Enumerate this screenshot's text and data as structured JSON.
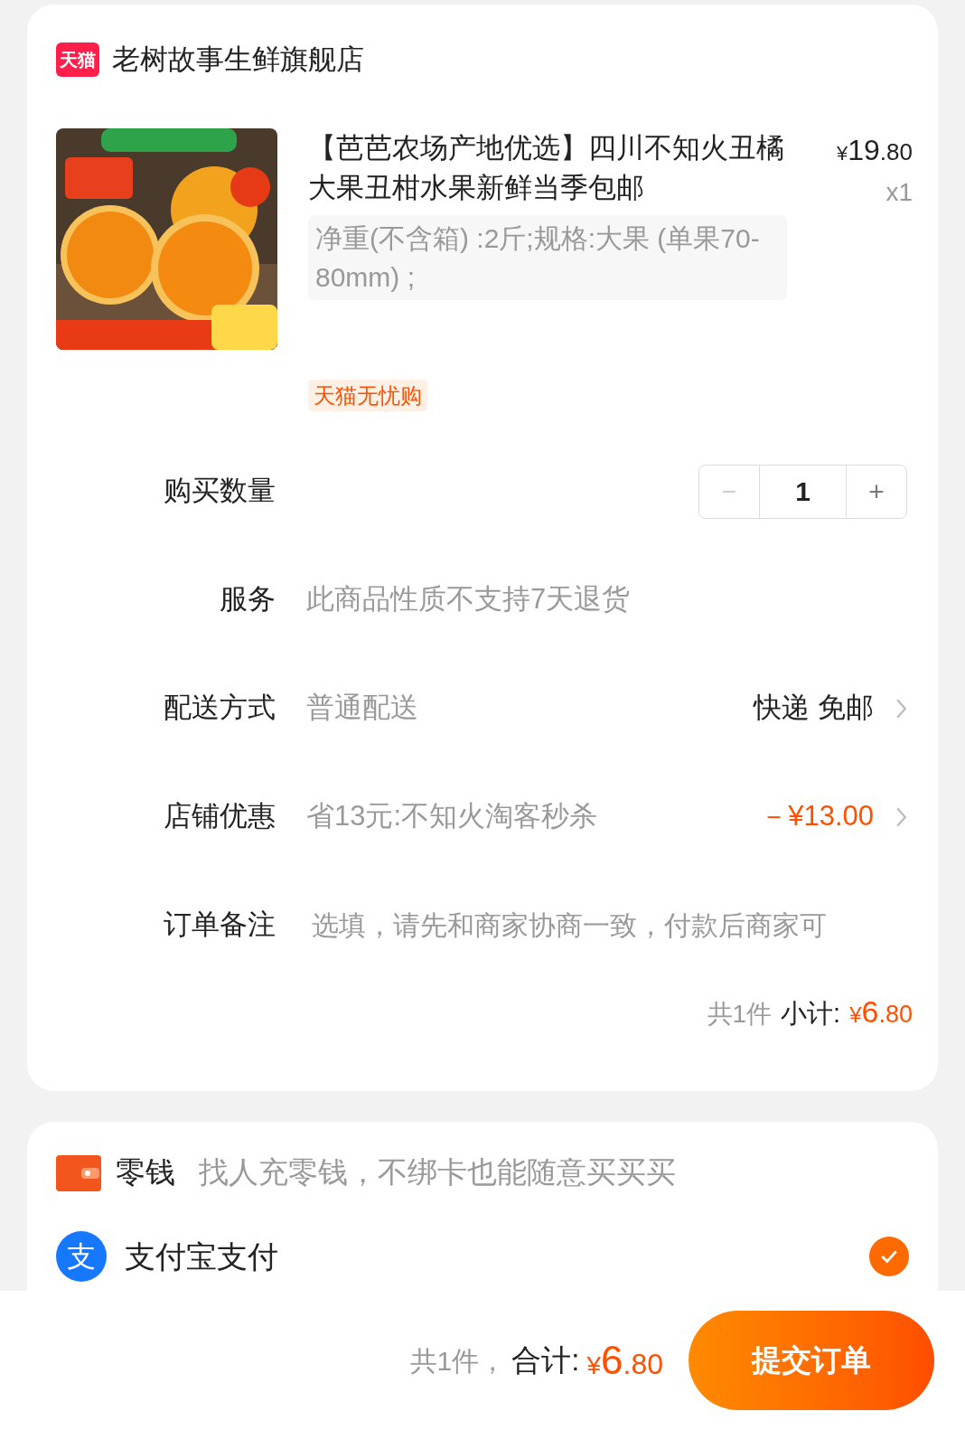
{
  "store": {
    "badge": "天猫",
    "name": "老树故事生鲜旗舰店"
  },
  "item": {
    "title": "【芭芭农场产地优选】四川不知火丑橘大果丑柑水果新鲜当季包邮",
    "price_symbol": "¥",
    "price_int": "19",
    "price_dec": ".80",
    "count": "x1",
    "spec": "净重(不含箱) :2斤;规格:大果 (单果70-80mm) ;",
    "tag": "天猫无忧购"
  },
  "rows": [
    {
      "kind": "stepper",
      "label": "购买数量",
      "minus": "−",
      "value": "1",
      "plus": "+",
      "minus_disabled": true
    },
    {
      "kind": "text",
      "label": "服务",
      "value": "此商品性质不支持7天退货"
    },
    {
      "kind": "link",
      "label": "配送方式",
      "value": "普通配送",
      "right": "快递 免邮",
      "accent": false
    },
    {
      "kind": "link",
      "label": "店铺优惠",
      "value": "省13元:不知火淘客秒杀",
      "right": "－¥13.00",
      "accent": true
    },
    {
      "kind": "input",
      "label": "订单备注",
      "placeholder": "选填，请先和商家协商一致，付款后商家可"
    }
  ],
  "subtotal": {
    "count": "共1件",
    "label": "小计:",
    "symbol": "¥",
    "int": "6",
    "dec": ".80"
  },
  "payments": [
    {
      "kind": "wallet",
      "name": "零钱",
      "note": "找人充零钱，不绑卡也能随意买买买"
    },
    {
      "kind": "alipay",
      "name": "支付宝支付",
      "icon_text": "支",
      "selected": true
    }
  ],
  "footer": {
    "count": "共1件，",
    "label": "合计:",
    "symbol": "¥",
    "int": "6",
    "dec": ".80",
    "submit": "提交订单"
  }
}
